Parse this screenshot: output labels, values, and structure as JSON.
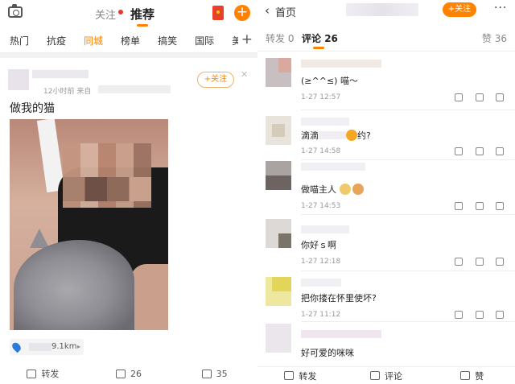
{
  "left": {
    "nav": {
      "follow": "关注",
      "recommend": "推荐"
    },
    "channels": [
      "热门",
      "抗疫",
      "同城",
      "榜单",
      "搞笑",
      "国际",
      "美"
    ],
    "active_channel_index": 2,
    "post": {
      "meta": "12小时前  来自",
      "follow_label": "+关注",
      "text": "做我的猫",
      "location_distance": "9.1km",
      "actions": {
        "repost": "转发",
        "comments": "26",
        "likes": "35"
      }
    }
  },
  "right": {
    "back_label": "首页",
    "follow_label": "+关注",
    "tabs": {
      "repost": "转发 0",
      "comment_label": "评论",
      "comment_count": "26",
      "like": "赞 36"
    },
    "comments": [
      {
        "text": "(≥^^≤) 喵～",
        "time": "1-27 12:57"
      },
      {
        "text": "滴滴",
        "text_after": "约?",
        "time": "1-27 14:58"
      },
      {
        "text": "做喵主人",
        "time": "1-27 14:53"
      },
      {
        "text": "你好ｓ啊",
        "time": "1-27 12:18"
      },
      {
        "text": "把你搂在怀里使坏?",
        "time": "1-27 11:12"
      },
      {
        "text": "好可爱的咪咪",
        "time": ""
      }
    ],
    "bottom": {
      "repost": "转发",
      "comment": "评论",
      "like": "赞"
    }
  },
  "colors": {
    "accent": "#ff8200",
    "link_blue": "#2e7bd6"
  }
}
